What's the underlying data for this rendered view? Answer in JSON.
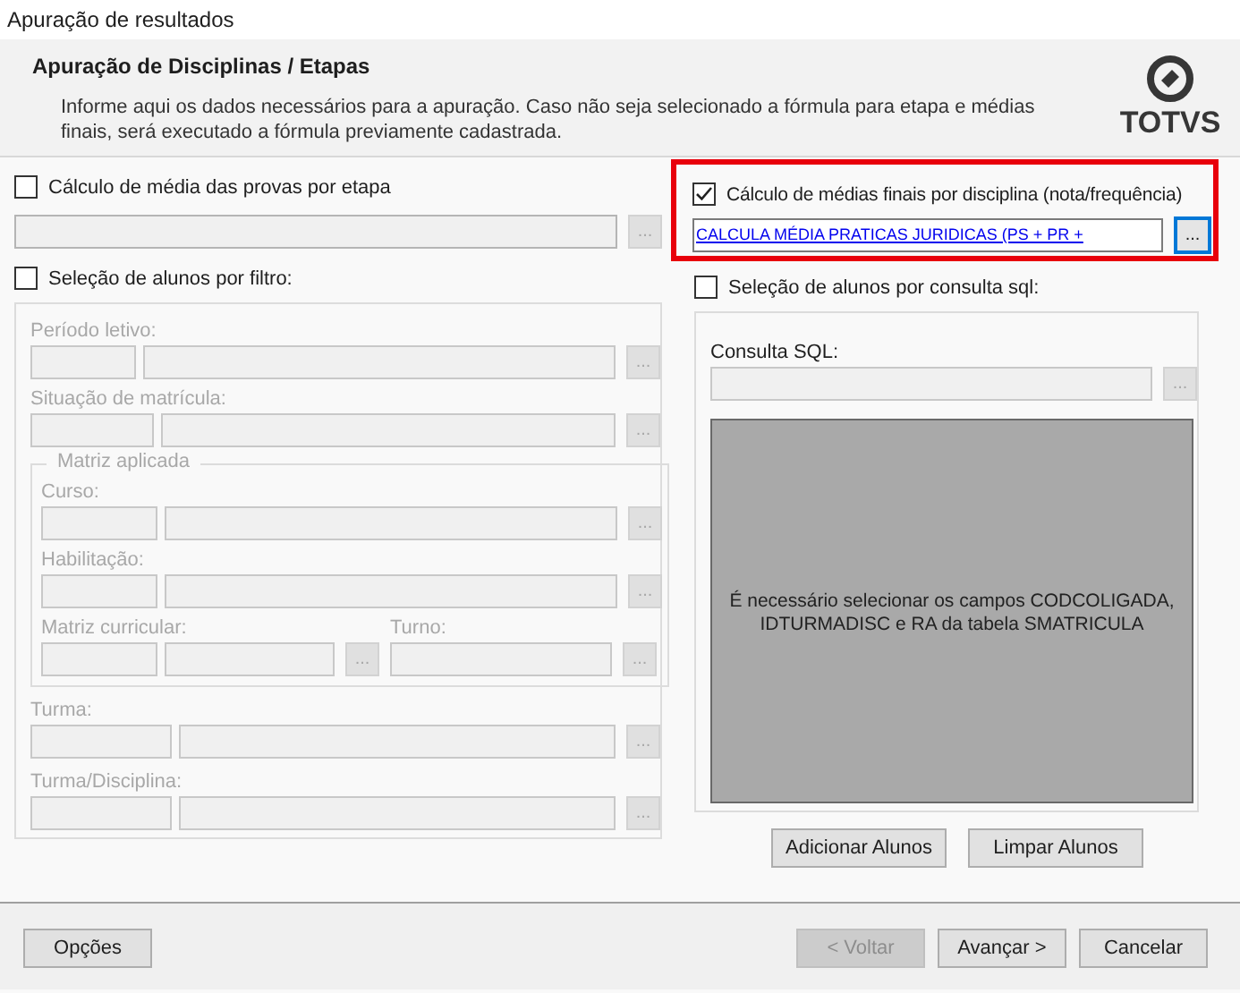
{
  "window": {
    "title": "Apuração de resultados"
  },
  "header": {
    "title": "Apuração de Disciplinas / Etapas",
    "description": "Informe aqui os dados necessários para a apuração. Caso não seja selecionado a fórmula para etapa e médias finais, será executado a fórmula previamente cadastrada.",
    "logo": "TOTVS"
  },
  "stage_average": {
    "label": "Cálculo de média das provas por etapa",
    "checked": false,
    "button": "..."
  },
  "final_average": {
    "label": "Cálculo de médias finais por disciplina (nota/frequência)",
    "checked": true,
    "highlighted": true,
    "value": "CALCULA MÉDIA PRATICAS JURIDICAS (PS + PR +",
    "button": "..."
  },
  "filter": {
    "label": "Seleção de alunos por filtro:",
    "checked": false,
    "disabled": true,
    "fields": [
      {
        "label": "Período letivo:",
        "button": "..."
      },
      {
        "label": "Situação de matrícula:",
        "button": "..."
      }
    ],
    "group": {
      "title": "Matriz aplicada",
      "fields": [
        {
          "label": "Curso:",
          "button": "..."
        },
        {
          "label": "Habilitação:",
          "button": "..."
        }
      ],
      "row": [
        {
          "label": "Matriz curricular:",
          "button": "..."
        },
        {
          "label": "Turno:",
          "button": "..."
        }
      ]
    },
    "fields_after": [
      {
        "label": "Turma:",
        "button": "..."
      },
      {
        "label": "Turma/Disciplina:",
        "button": "..."
      }
    ]
  },
  "sql": {
    "label": "Seleção de alunos por consulta sql:",
    "checked": false,
    "field_label": "Consulta SQL:",
    "button": "...",
    "message": "É necessário selecionar os campos CODCOLIGADA, IDTURMADISC e RA da tabela SMATRICULA",
    "actions": [
      "Adicionar Alunos",
      "Limpar Alunos"
    ]
  },
  "footer": {
    "buttons": [
      {
        "label": "Opções",
        "disabled": false
      },
      {
        "label": "< Voltar",
        "disabled": true
      },
      {
        "label": "Avançar >",
        "disabled": false
      },
      {
        "label": "Cancelar",
        "disabled": false
      }
    ]
  }
}
